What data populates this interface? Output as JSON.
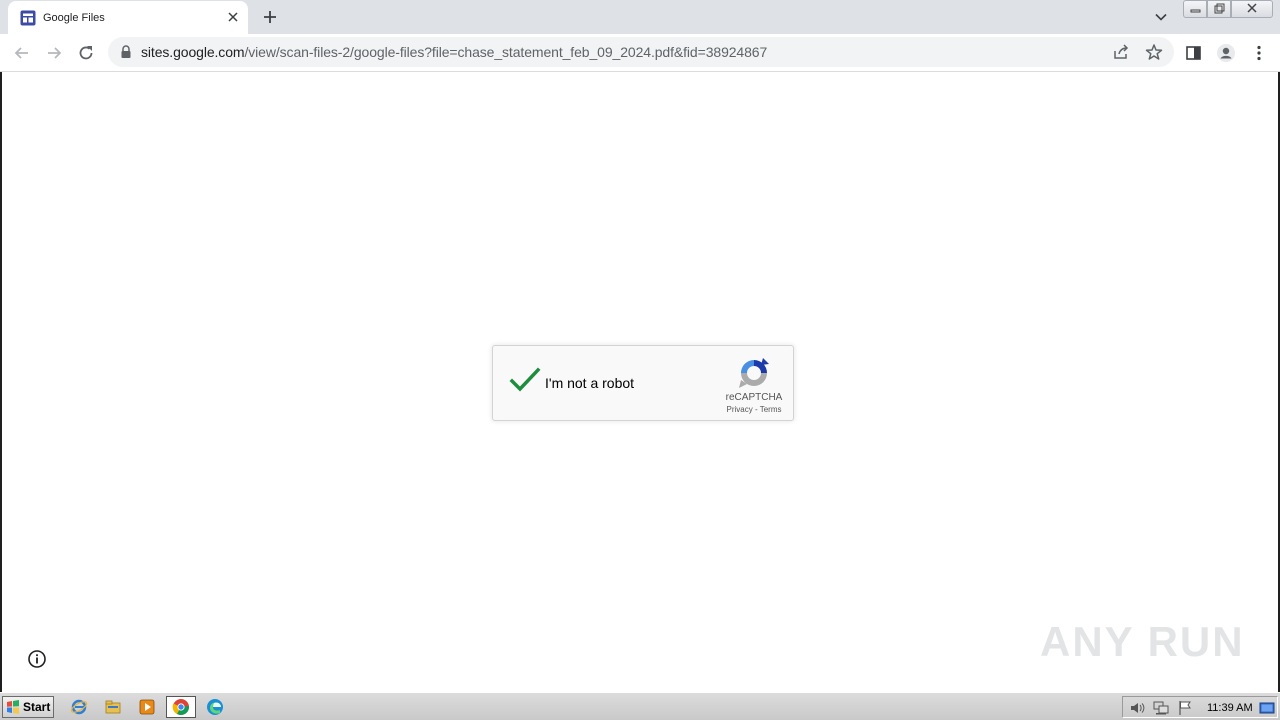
{
  "browser": {
    "tab": {
      "title": "Google Files"
    },
    "address_bar": {
      "host": "sites.google.com",
      "path": "/view/scan-files-2/google-files?file=chase_statement_feb_09_2024.pdf&fid=38924867"
    }
  },
  "recaptcha": {
    "label": "I'm not a robot",
    "brand": "reCAPTCHA",
    "privacy_link": "Privacy",
    "separator": " - ",
    "terms_link": "Terms",
    "checked": true,
    "check_color": "#1e8e3e"
  },
  "watermark": {
    "text": "ANY RUN"
  },
  "taskbar": {
    "start_label": "Start",
    "clock": "11:39 AM"
  },
  "icons": {
    "tab_favicon": "google-sites-icon",
    "tab_close": "close-icon",
    "new_tab": "plus-icon",
    "back": "arrow-left-icon",
    "forward": "arrow-right-icon",
    "reload": "reload-icon",
    "lock": "lock-icon",
    "share": "share-icon",
    "bookmark": "star-icon",
    "side_panel": "side-panel-icon",
    "profile": "profile-icon",
    "menu": "kebab-menu-icon",
    "info": "info-icon"
  }
}
